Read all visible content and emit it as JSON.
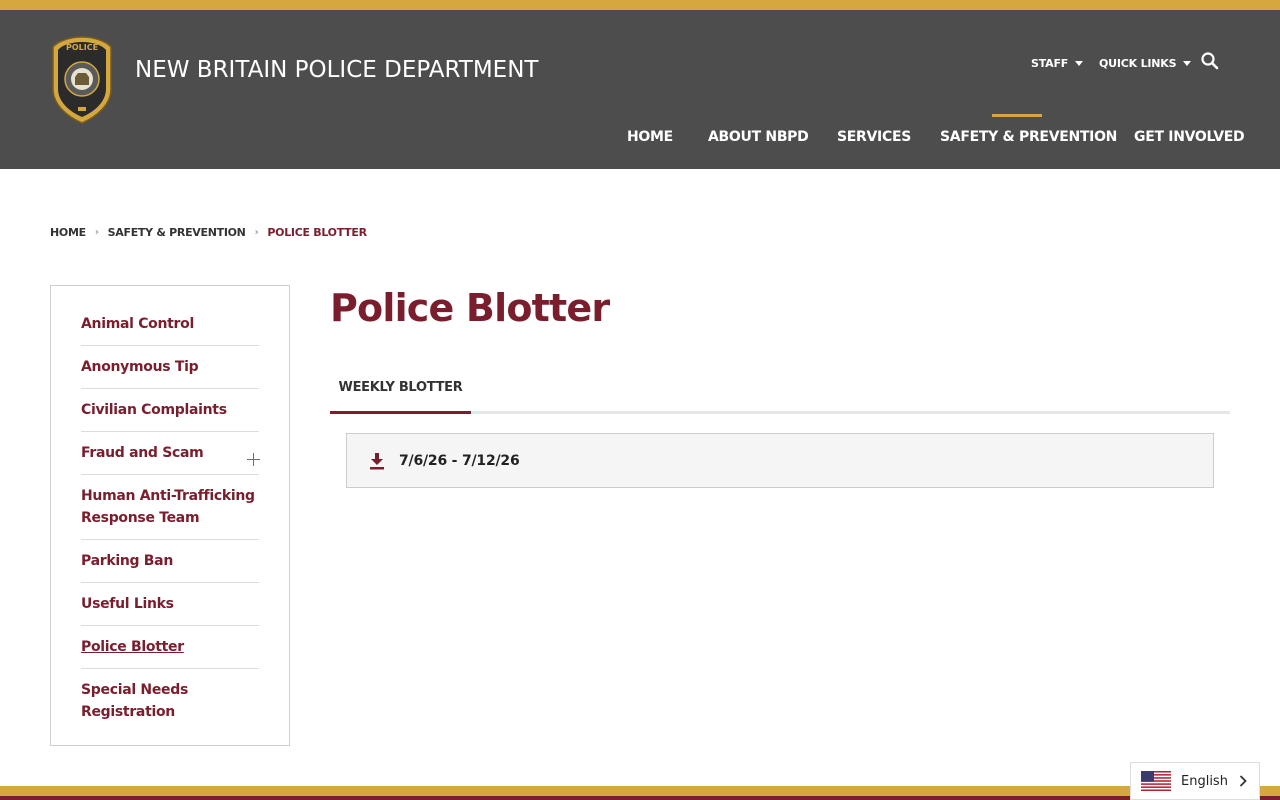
{
  "colors": {
    "accent_gold": "#d4a83f",
    "header_bg": "#4d4d4d",
    "brand_maroon": "#7a1e2e"
  },
  "header": {
    "site_title": "NEW BRITAIN POLICE DEPARTMENT",
    "logo_icon": "police-badge-icon",
    "logo_text": "POLICE",
    "utility": {
      "staff_label": "STAFF",
      "quick_links_label": "QUICK LINKS",
      "search_icon": "search-icon"
    },
    "nav": [
      {
        "label": "HOME"
      },
      {
        "label": "ABOUT NBPD"
      },
      {
        "label": "SERVICES"
      },
      {
        "label": "SAFETY & PREVENTION",
        "active": true
      },
      {
        "label": "GET INVOLVED"
      }
    ]
  },
  "breadcrumb": [
    {
      "label": "HOME"
    },
    {
      "label": "SAFETY & PREVENTION"
    },
    {
      "label": "POLICE BLOTTER",
      "current": true
    }
  ],
  "sidebar": {
    "items": [
      {
        "label": "Animal Control"
      },
      {
        "label": "Anonymous Tip"
      },
      {
        "label": "Civilian Complaints"
      },
      {
        "label": "Fraud and Scam",
        "expandable": true,
        "expand_icon": "plus-icon"
      },
      {
        "label": "Human Anti-Trafficking Response Team"
      },
      {
        "label": "Parking Ban"
      },
      {
        "label": "Useful Links"
      },
      {
        "label": "Police Blotter",
        "current": true
      },
      {
        "label": "Special Needs Registration"
      }
    ]
  },
  "main": {
    "page_title": "Police Blotter",
    "tabs": [
      {
        "label": "WEEKLY BLOTTER",
        "active": true
      }
    ],
    "documents": [
      {
        "label": "7/6/26 - 7/12/26",
        "icon": "download-icon"
      }
    ]
  },
  "language": {
    "label": "English",
    "flag_icon": "us-flag-icon",
    "chevron_icon": "chevron-right-icon"
  }
}
